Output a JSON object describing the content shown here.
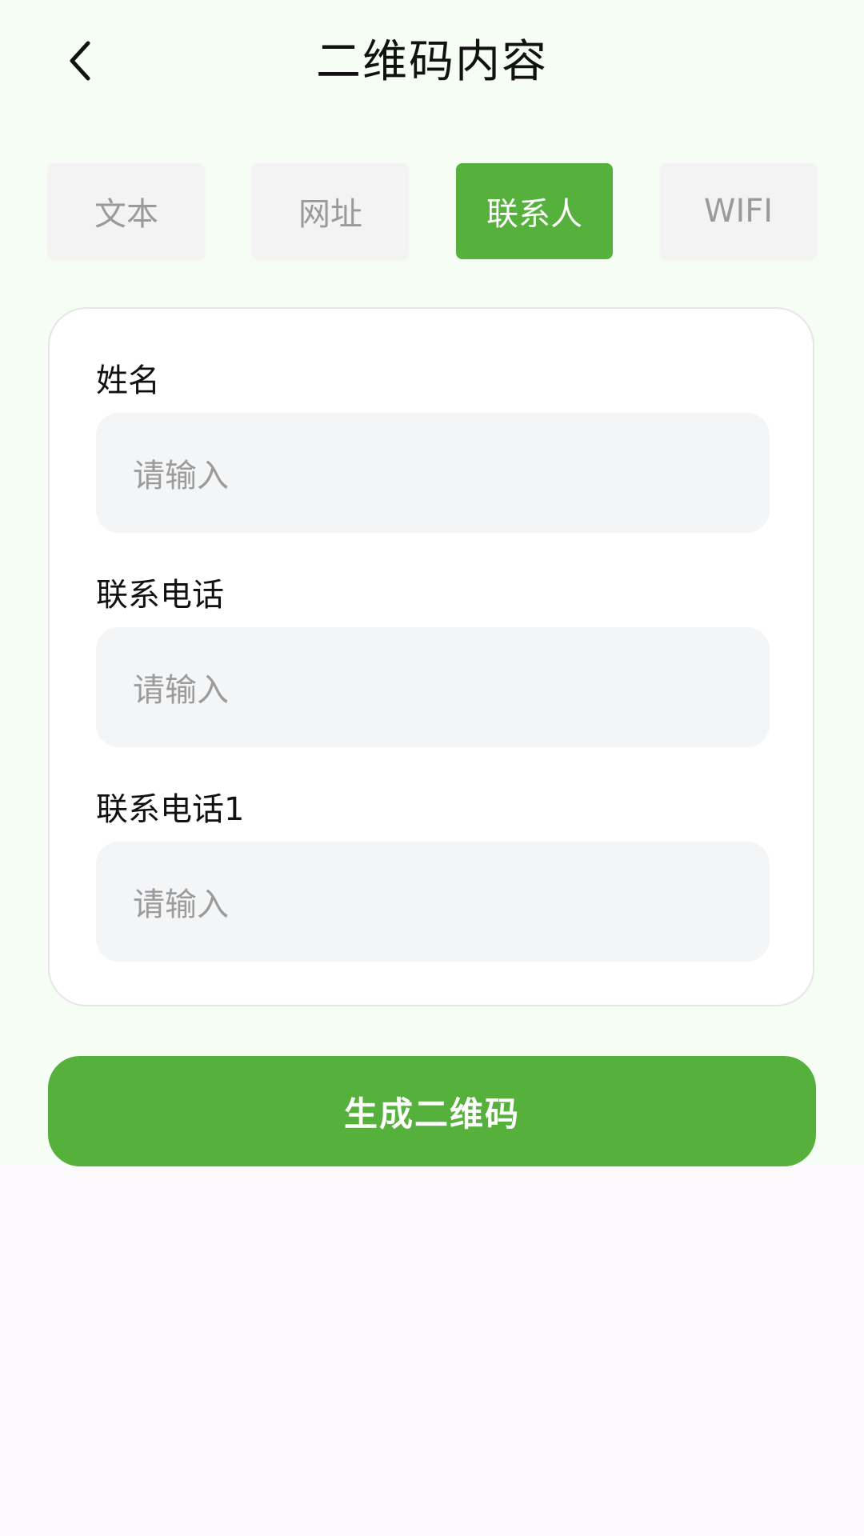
{
  "header": {
    "title": "二维码内容",
    "back_icon": "chevron-left-icon"
  },
  "tabs": [
    {
      "label": "文本",
      "active": false
    },
    {
      "label": "网址",
      "active": false
    },
    {
      "label": "联系人",
      "active": true
    },
    {
      "label": "WIFI",
      "active": false
    }
  ],
  "form": {
    "fields": [
      {
        "label": "姓名",
        "value": "",
        "placeholder": "请输入"
      },
      {
        "label": "联系电话",
        "value": "",
        "placeholder": "请输入"
      },
      {
        "label": "联系电话1",
        "value": "",
        "placeholder": "请输入"
      }
    ]
  },
  "actions": {
    "generate_label": "生成二维码"
  },
  "colors": {
    "accent": "#55b13b",
    "page_background": "#f6fdf4",
    "input_background": "#f4f5f7",
    "tab_inactive_background": "#f3f3f3",
    "placeholder_text": "#9b9b9b"
  }
}
